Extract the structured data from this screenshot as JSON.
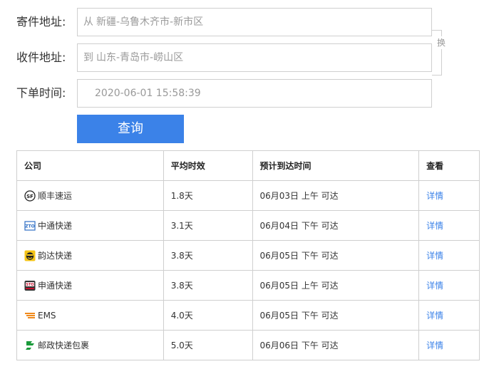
{
  "form": {
    "sender_label": "寄件地址:",
    "sender_prefix": "从",
    "sender_value": "新疆-乌鲁木齐市-新市区",
    "receiver_label": "收件地址:",
    "receiver_prefix": "到",
    "receiver_value": "山东-青岛市-崂山区",
    "swap_label": "换",
    "time_label": "下单时间:",
    "time_value": "2020-06-01 15:58:39",
    "query_label": "查询"
  },
  "table": {
    "headers": [
      "公司",
      "平均时效",
      "预计到达时间",
      "查看"
    ],
    "rows": [
      {
        "company": "顺丰速运",
        "icon": "sf-express-icon",
        "avg": "1.8天",
        "eta": "06月03日 上午 可达",
        "view": "详情"
      },
      {
        "company": "中通快递",
        "icon": "zto-express-icon",
        "avg": "3.1天",
        "eta": "06月04日 下午 可达",
        "view": "详情"
      },
      {
        "company": "韵达快递",
        "icon": "yunda-express-icon",
        "avg": "3.8天",
        "eta": "06月05日 下午 可达",
        "view": "详情"
      },
      {
        "company": "申通快递",
        "icon": "sto-express-icon",
        "avg": "3.8天",
        "eta": "06月05日 上午 可达",
        "view": "详情"
      },
      {
        "company": "EMS",
        "icon": "ems-icon",
        "avg": "4.0天",
        "eta": "06月05日 下午 可达",
        "view": "详情"
      },
      {
        "company": "邮政快递包裹",
        "icon": "china-post-icon",
        "avg": "5.0天",
        "eta": "06月06日 下午 可达",
        "view": "详情"
      }
    ]
  },
  "colors": {
    "accent": "#3b82e8",
    "border": "#cfcfcf",
    "placeholder_text": "#999999"
  }
}
